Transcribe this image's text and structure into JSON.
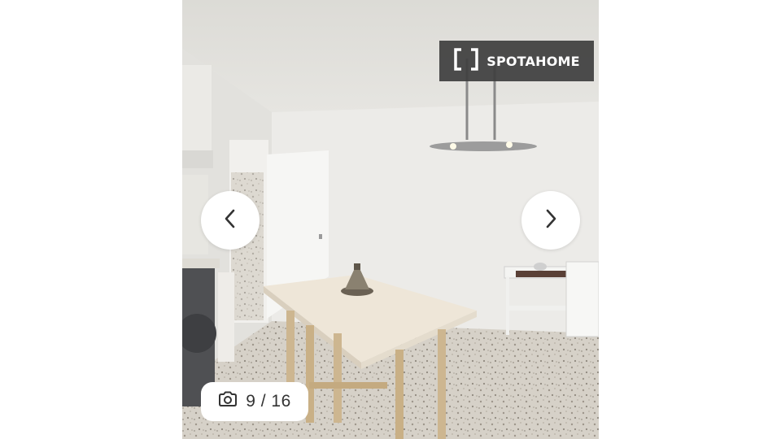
{
  "brand": {
    "name": "SPOTAHOME",
    "icon": "bracket-logo-icon"
  },
  "gallery": {
    "counter_text": "9 / 16",
    "current_index": 9,
    "total_images": 16,
    "counter_icon": "camera-icon",
    "prev_icon": "chevron-left-icon",
    "next_icon": "chevron-right-icon"
  },
  "colors": {
    "badge_background": "#3e3e3e",
    "button_background": "#ffffff",
    "text": "#333333"
  }
}
